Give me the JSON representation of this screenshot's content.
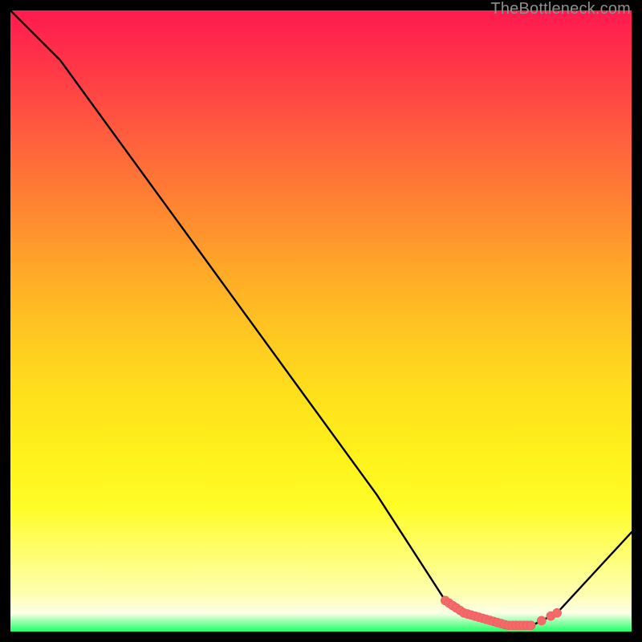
{
  "watermark": "TheBottleneck.com",
  "colors": {
    "background": "#000000",
    "line": "#000000",
    "marker": "#f46a6a",
    "marker_stroke": "#ee5a5a"
  },
  "chart_data": {
    "type": "line",
    "title": "",
    "xlabel": "",
    "ylabel": "",
    "xlim": [
      0,
      100
    ],
    "ylim": [
      0,
      100
    ],
    "x": [
      0,
      8,
      59,
      70,
      73,
      80,
      84,
      88,
      100
    ],
    "values": [
      100,
      92,
      22,
      5,
      3,
      1,
      1,
      3,
      16
    ],
    "marker_region": {
      "x_start": 70,
      "x_end": 88,
      "note": "dense coral markers along valley floor"
    }
  }
}
